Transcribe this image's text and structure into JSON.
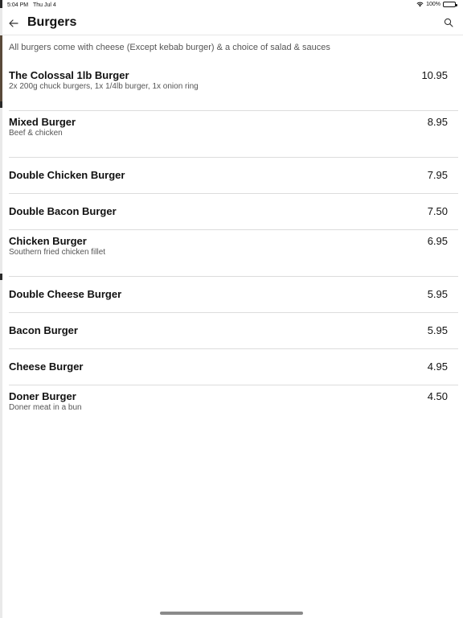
{
  "status_bar": {
    "time": "5:04 PM",
    "date": "Thu Jul 4",
    "battery": "100%",
    "icons": [
      "wifi-icon",
      "battery-icon"
    ]
  },
  "nav": {
    "back_icon": "arrow-left-icon",
    "title": "Burgers",
    "search_icon": "search-icon"
  },
  "category": {
    "description": "All burgers come with cheese (Except kebab burger) & a choice of salad & sauces"
  },
  "menu_items": [
    {
      "name": "The Colossal 1lb Burger",
      "description": "2x 200g chuck burgers, 1x 1/4lb burger, 1x onion ring",
      "price": "10.95"
    },
    {
      "name": "Mixed Burger",
      "description": "Beef & chicken",
      "price": "8.95"
    },
    {
      "name": "Double Chicken Burger",
      "description": "",
      "price": "7.95"
    },
    {
      "name": "Double Bacon Burger",
      "description": "",
      "price": "7.50"
    },
    {
      "name": "Chicken Burger",
      "description": "Southern fried chicken fillet",
      "price": "6.95"
    },
    {
      "name": "Double Cheese Burger",
      "description": "",
      "price": "5.95"
    },
    {
      "name": "Bacon Burger",
      "description": "",
      "price": "5.95"
    },
    {
      "name": "Cheese Burger",
      "description": "",
      "price": "4.95"
    },
    {
      "name": "Doner Burger",
      "description": "Doner meat in a bun",
      "price": "4.50"
    }
  ]
}
